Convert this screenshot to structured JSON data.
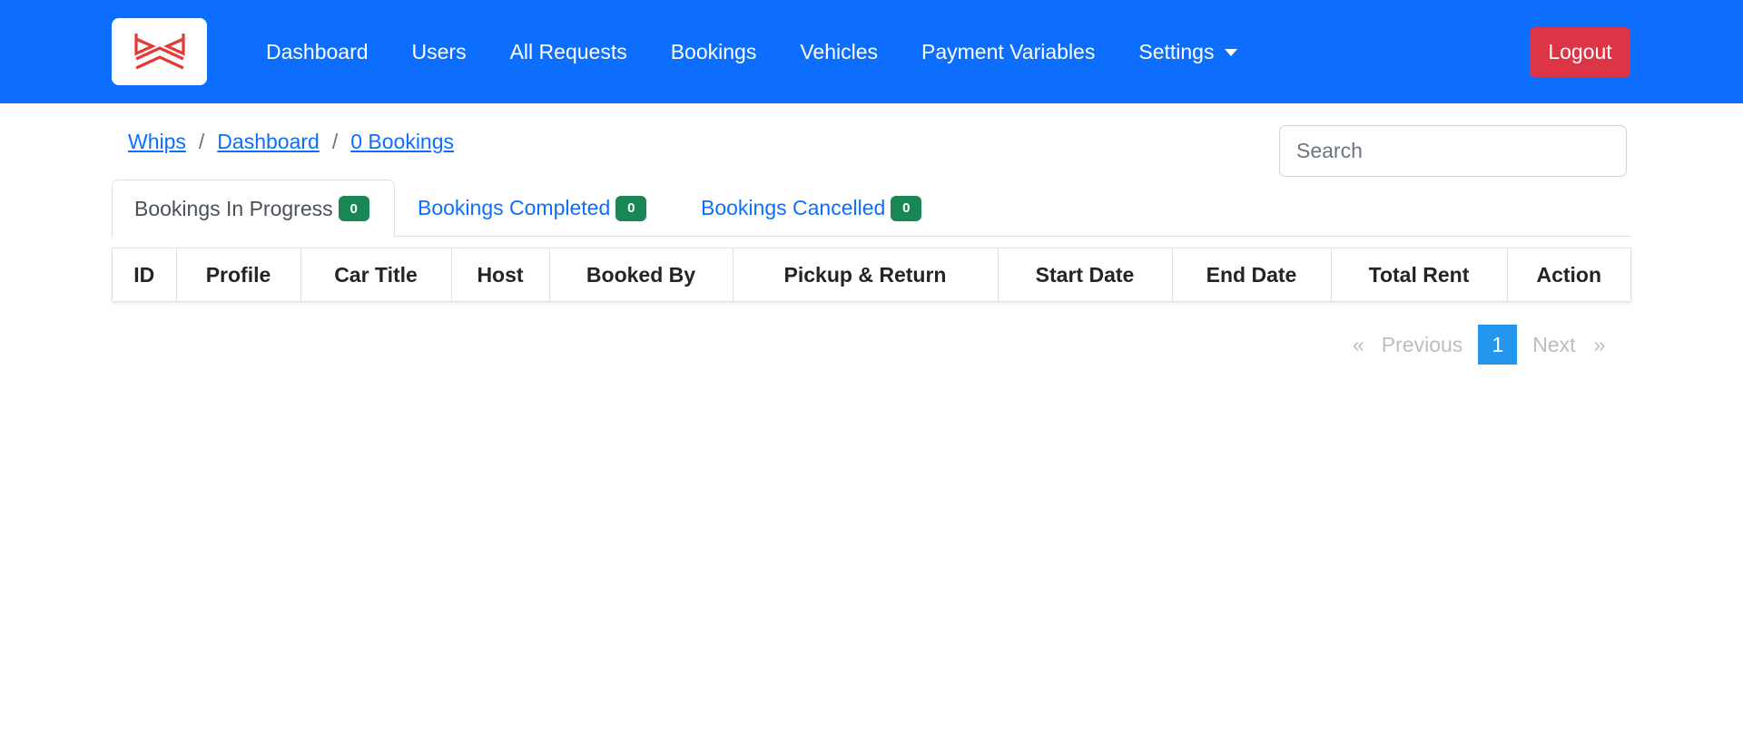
{
  "navbar": {
    "brand_color": "#0d6efd",
    "logo_icon": "whips-logo",
    "items": [
      {
        "label": "Dashboard"
      },
      {
        "label": "Users"
      },
      {
        "label": "All Requests"
      },
      {
        "label": "Bookings"
      },
      {
        "label": "Vehicles"
      },
      {
        "label": "Payment Variables"
      },
      {
        "label": "Settings",
        "dropdown": true
      }
    ],
    "logout_label": "Logout",
    "logout_color": "#dc3545"
  },
  "breadcrumb": [
    "Whips",
    "Dashboard",
    "0 Bookings"
  ],
  "search": {
    "placeholder": "Search",
    "value": ""
  },
  "tabs": [
    {
      "label": "Bookings In Progress",
      "count": "0",
      "active": true
    },
    {
      "label": "Bookings Completed",
      "count": "0",
      "active": false
    },
    {
      "label": "Bookings Cancelled",
      "count": "0",
      "active": false
    }
  ],
  "badge_color": "#198754",
  "table": {
    "columns": [
      "ID",
      "Profile",
      "Car Title",
      "Host",
      "Booked By",
      "Pickup & Return",
      "Start Date",
      "End Date",
      "Total Rent",
      "Action"
    ],
    "rows": []
  },
  "pagination": {
    "first": "«",
    "previous": "Previous",
    "current_page": "1",
    "next": "Next",
    "last": "»",
    "active_color": "#2496ed"
  }
}
